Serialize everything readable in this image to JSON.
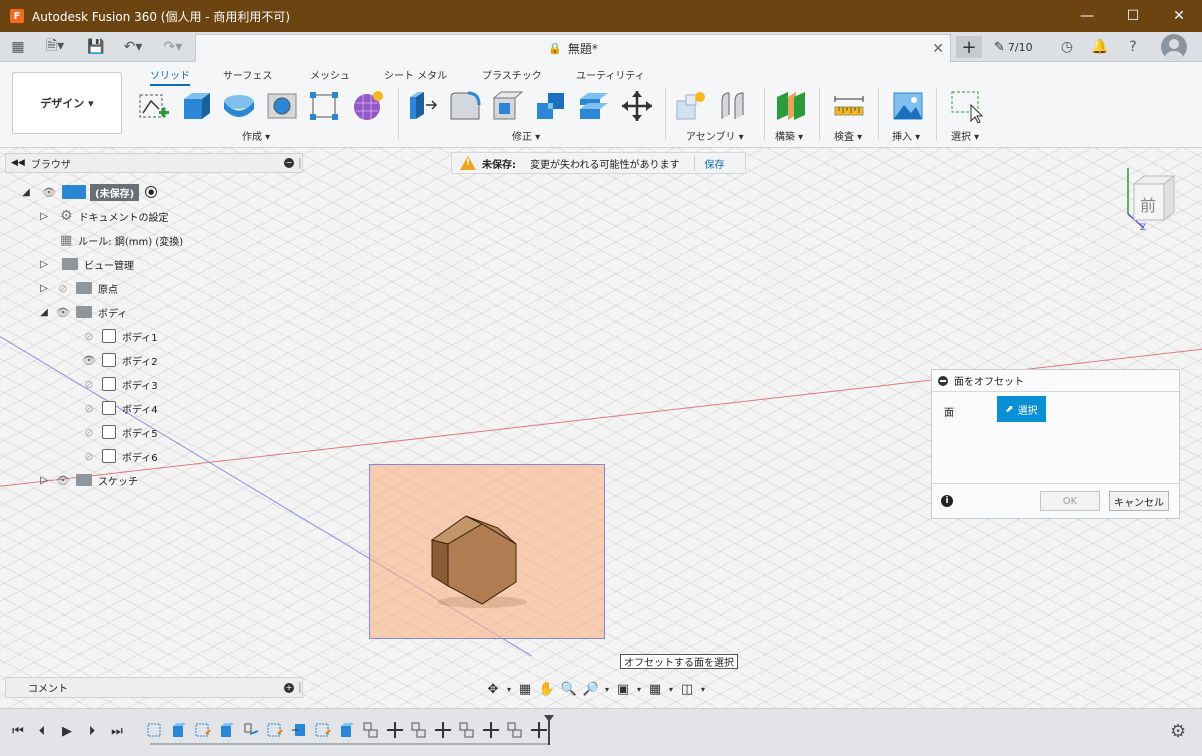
{
  "titlebar": {
    "logo": "F",
    "title": "Autodesk Fusion 360 (個人用 - 商用利用不可)",
    "icons": [
      "minimize-icon",
      "maximize-icon",
      "close-icon"
    ]
  },
  "apptoolbar": {
    "doc_title": "無題*",
    "jobs": "7/10",
    "icons": [
      "grid-icon",
      "file-icon",
      "save-icon",
      "undo-icon",
      "redo-icon",
      "lock-icon",
      "close-tab-icon",
      "plus-icon",
      "jobs-icon",
      "clock-icon",
      "bell-icon",
      "help-icon",
      "avatar"
    ]
  },
  "ribbon": {
    "workspace": "デザイン ▾",
    "tabs": [
      {
        "label": "ソリッド",
        "active": true
      },
      {
        "label": "サーフェス",
        "active": false
      },
      {
        "label": "メッシュ",
        "active": false
      },
      {
        "label": "シート メタル",
        "active": false
      },
      {
        "label": "プラスチック",
        "active": false
      },
      {
        "label": "ユーティリティ",
        "active": false
      }
    ],
    "groups": {
      "create": "作成 ▾",
      "modify": "修正 ▾",
      "assemble": "アセンブリ ▾",
      "construct": "構築 ▾",
      "inspect": "検査 ▾",
      "insert": "挿入 ▾",
      "select": "選択 ▾"
    }
  },
  "browser": {
    "title": "ブラウザ",
    "root": "(未保存)",
    "items": {
      "doc_settings": "ドキュメントの設定",
      "rule": "ルール: 鋼(mm) (変換)",
      "views": "ビュー管理",
      "origin": "原点",
      "bodies": "ボディ",
      "body1": "ボディ1",
      "body2": "ボディ2",
      "body3": "ボディ3",
      "body4": "ボディ4",
      "body5": "ボディ5",
      "body6": "ボディ6",
      "sketches": "スケッチ"
    }
  },
  "unsaved": {
    "label": "未保存:",
    "message": "変更が失われる可能性があります",
    "save": "保存"
  },
  "viewcube": {
    "face": "前",
    "z": "Z"
  },
  "dialog": {
    "title": "面をオフセット",
    "face_label": "面",
    "select_label": "選択",
    "ok": "OK",
    "cancel": "キャンセル"
  },
  "tooltip": "オフセットする面を選択",
  "comments": {
    "title": "コメント"
  },
  "colors": {
    "titlebar": "#6b4411",
    "accent": "#0a6ebd",
    "select_button": "#0a8fd6",
    "sketch_plane": "#f8b084",
    "body": "#b07c52",
    "warning": "#f0a21a"
  }
}
